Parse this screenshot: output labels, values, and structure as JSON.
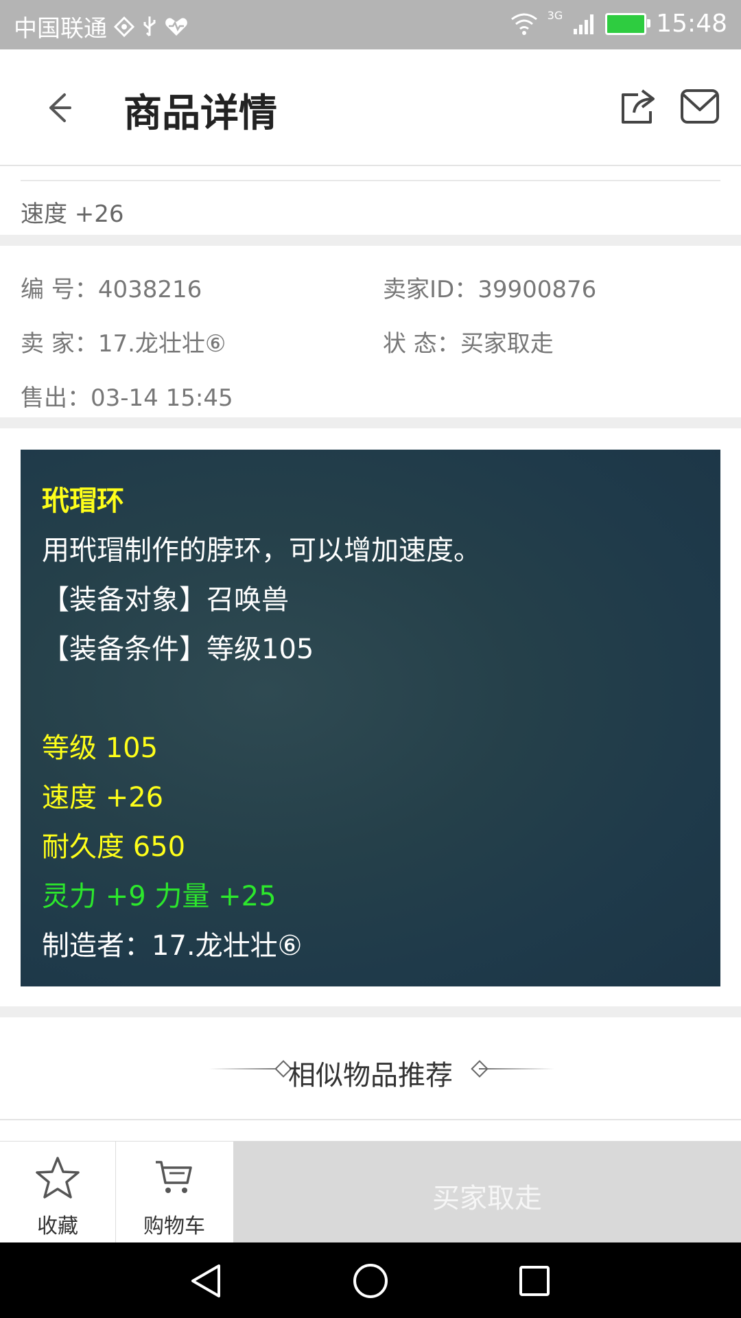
{
  "status_bar": {
    "carrier": "中国联通",
    "network": "3G",
    "time": "15:48"
  },
  "header": {
    "title": "商品详情"
  },
  "top_item": {
    "text": "速度 +26"
  },
  "info": {
    "id_label": "编 号：",
    "id_value": "4038216",
    "seller_id_label": "卖家ID：",
    "seller_id_value": "39900876",
    "seller_label": "卖 家：",
    "seller_value": "17.龙壮壮⑥",
    "status_label": "状 态：",
    "status_value": "买家取走",
    "sold_label": "售出：",
    "sold_value": "03-14 15:45"
  },
  "item_card": {
    "name": "玳瑁环",
    "description": "用玳瑁制作的脖环，可以增加速度。",
    "equip_target": "【装备对象】召唤兽",
    "equip_condition": "【装备条件】等级105",
    "level": "等级 105",
    "speed": "速度 +26",
    "durability": "耐久度 650",
    "bonus": "灵力 +9 力量 +25",
    "maker": "制造者：17.龙壮壮⑥"
  },
  "recommend": {
    "title": "相似物品推荐"
  },
  "bottom_bar": {
    "favorite_label": "收藏",
    "cart_label": "购物车",
    "buy_label": "买家取走"
  },
  "colors": {
    "yellow": "#ffff1a",
    "green": "#2ce82c",
    "card_bg": "#1f3a4a"
  }
}
